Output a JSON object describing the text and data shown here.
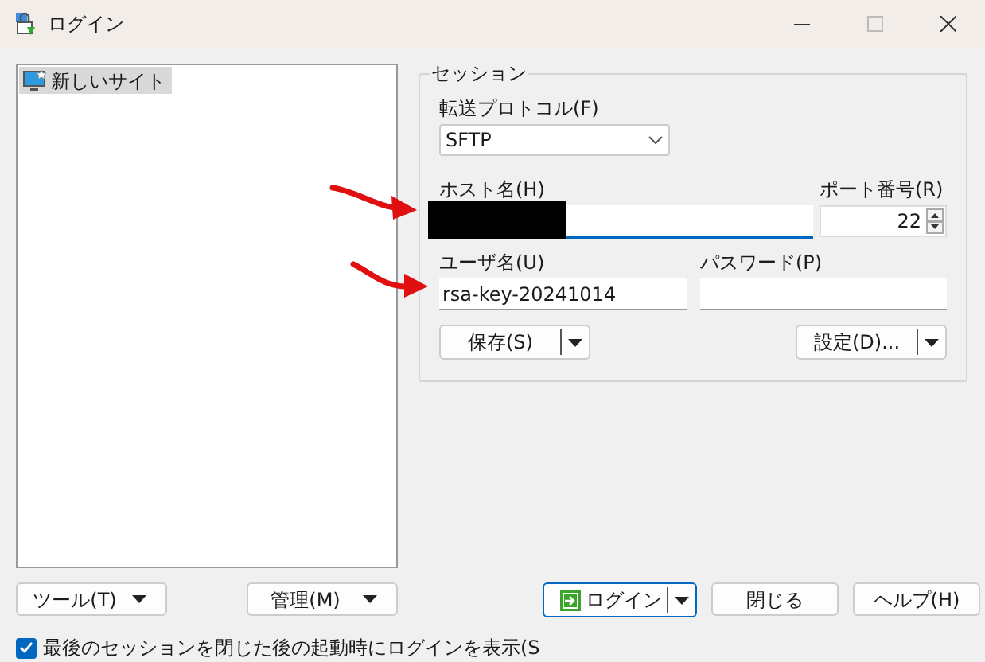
{
  "window": {
    "title": "ログイン"
  },
  "site_tree": {
    "items": [
      {
        "label": "新しいサイト",
        "selected": true
      }
    ]
  },
  "session": {
    "title": "セッション",
    "protocol": {
      "label": "転送プロトコル(F)",
      "value": "SFTP"
    },
    "host": {
      "label": "ホスト名(H)"
    },
    "port": {
      "label": "ポート番号(R)",
      "value": "22"
    },
    "user": {
      "label": "ユーザ名(U)",
      "value": "rsa-key-20241014"
    },
    "password": {
      "label": "パスワード(P)"
    },
    "save_button": "保存(S)",
    "advanced_button": "設定(D)..."
  },
  "left_buttons": [
    "ツール(T)",
    "管理(M)"
  ],
  "login_button": "ログイン",
  "close_button": "閉じる",
  "help_button": "ヘルプ(H)",
  "show_login_checkbox": {
    "label": "最後のセッションを閉じた後の起動時にログインを表示(S",
    "checked": true
  }
}
